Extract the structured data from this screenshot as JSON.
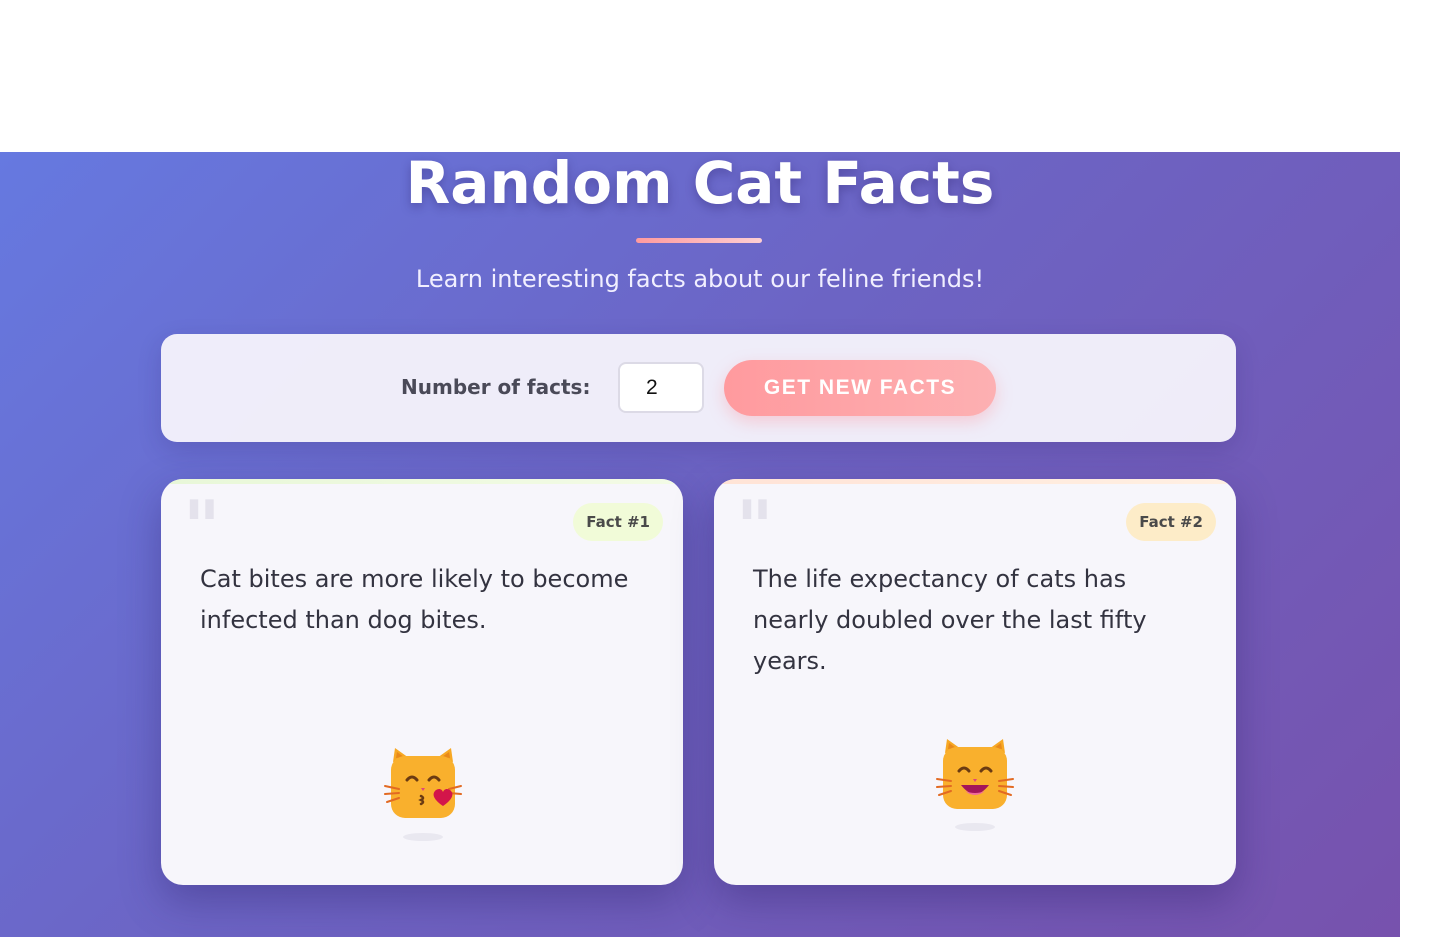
{
  "header": {
    "title": "Random Cat Facts",
    "subtitle": "Learn interesting facts about our feline friends!"
  },
  "controls": {
    "count_label": "Number of facts:",
    "count_value": "2",
    "button_label": "GET NEW FACTS"
  },
  "facts": [
    {
      "badge": "Fact #1",
      "text": "Cat bites are more likely to become infected than dog bites.",
      "icon": "kissing-cat-icon"
    },
    {
      "badge": "Fact #2",
      "text": "The life expectancy of cats has nearly doubled over the last fifty years.",
      "icon": "grinning-cat-icon"
    }
  ],
  "colors": {
    "gradient_start": "#6679e0",
    "gradient_end": "#7752ad",
    "accent": "#ff9a9e",
    "card_background": "#f7f6fb"
  }
}
